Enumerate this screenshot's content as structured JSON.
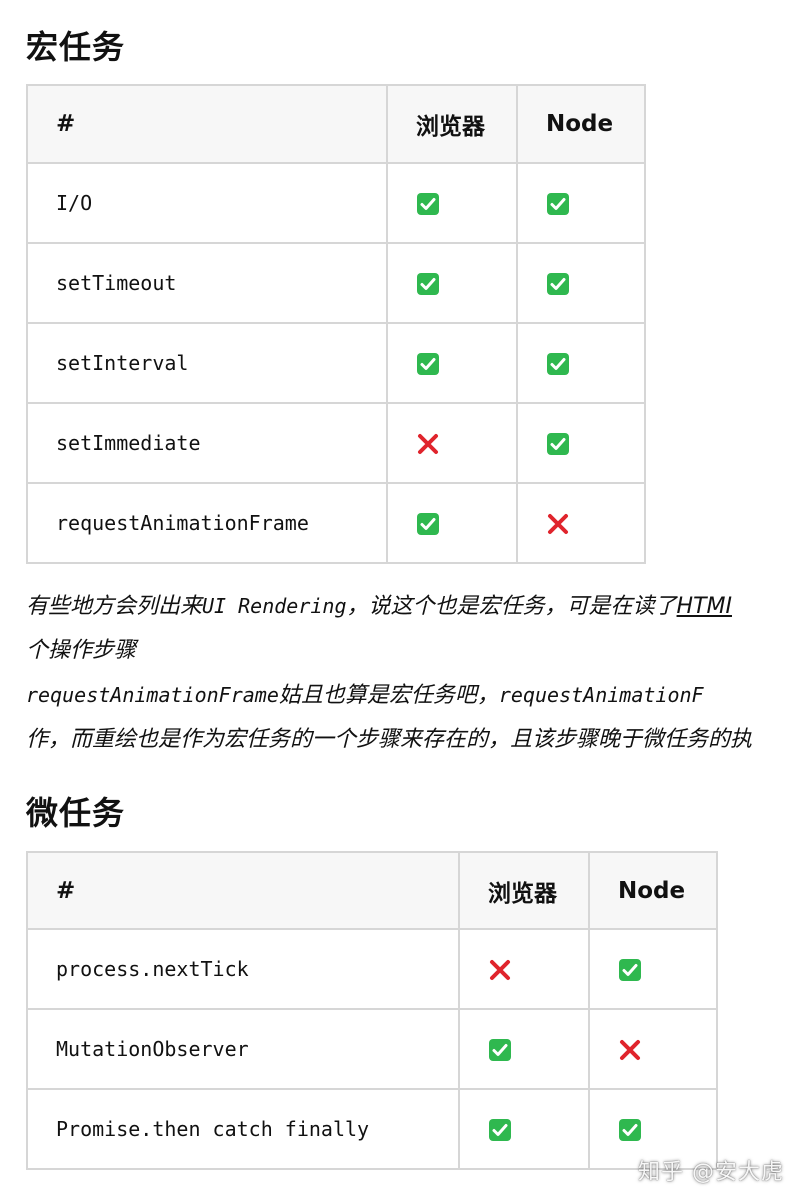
{
  "section1": {
    "title": "宏任务",
    "headers": [
      "#",
      "浏览器",
      "Node"
    ],
    "rows": [
      {
        "name": "I/O",
        "browser": "yes",
        "node": "yes"
      },
      {
        "name": "setTimeout",
        "browser": "yes",
        "node": "yes"
      },
      {
        "name": "setInterval",
        "browser": "yes",
        "node": "yes"
      },
      {
        "name": "setImmediate",
        "browser": "no",
        "node": "yes"
      },
      {
        "name": "requestAnimationFrame",
        "browser": "yes",
        "node": "no"
      }
    ]
  },
  "paragraph": {
    "l1_a": "有些地方会列出来",
    "l1_code": "UI Rendering",
    "l1_b": "，说这个也是宏任务，可是在读了",
    "l1_link": "HTMI",
    "l2": "个操作步骤",
    "l3_code": "requestAnimationFrame",
    "l3_b": "姑且也算是宏任务吧，",
    "l3_code2": "requestAnimationF",
    "l4": "作，而重绘也是作为宏任务的一个步骤来存在的，且该步骤晚于微任务的执"
  },
  "section2": {
    "title": "微任务",
    "headers": [
      "#",
      "浏览器",
      "Node"
    ],
    "rows": [
      {
        "name": "process.nextTick",
        "browser": "no",
        "node": "yes"
      },
      {
        "name": "MutationObserver",
        "browser": "yes",
        "node": "no"
      },
      {
        "name": "Promise.then catch finally",
        "browser": "yes",
        "node": "yes"
      }
    ]
  },
  "watermark": "知乎 @安大虎",
  "icons": {
    "yes": "check-mark-icon",
    "no": "cross-mark-icon"
  },
  "colors": {
    "check_bg": "#2fb84f",
    "cross": "#e0242c",
    "border": "#d6d6d6",
    "header_bg": "#f7f7f7"
  }
}
